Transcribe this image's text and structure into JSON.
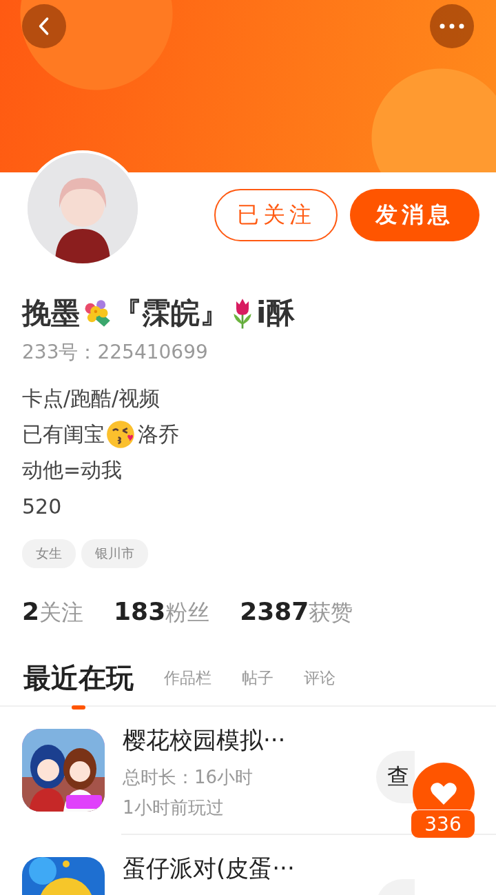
{
  "actions": [
    {
      "label": "已关注",
      "kind": "outline"
    },
    {
      "label": "发消息",
      "kind": "filled"
    }
  ],
  "name": [
    {
      "kind": "text",
      "text": "挽墨"
    },
    {
      "kind": "bouquet"
    },
    {
      "kind": "text",
      "text": "『霂皖』"
    },
    {
      "kind": "tulip"
    },
    {
      "kind": "text",
      "text": "i酥"
    }
  ],
  "id_line": "233号：225410699",
  "bio": [
    [
      {
        "kind": "text",
        "text": "卡点/跑酷/视频"
      }
    ],
    [
      {
        "kind": "text",
        "text": "已有闺宝"
      },
      {
        "kind": "kiss"
      },
      {
        "kind": "text",
        "text": "洛乔"
      }
    ],
    [
      {
        "kind": "text",
        "text": "动他=动我"
      }
    ],
    [
      {
        "kind": "text",
        "text": "520"
      }
    ]
  ],
  "tags": [
    "女生",
    "银川市"
  ],
  "stats": [
    "**2**关注",
    "**183**粉丝",
    "**2387**获赞"
  ],
  "tabs": [
    {
      "label": "最近在玩",
      "selected": true
    },
    {
      "label": "作品栏",
      "selected": false
    },
    {
      "label": "帖子",
      "selected": false
    },
    {
      "label": "评论",
      "selected": false
    }
  ],
  "games": [
    {
      "title": "樱花校园模拟···",
      "duration": "总时长：16小时",
      "last_played": "1小时前玩过",
      "button": "查"
    },
    {
      "title": "蛋仔派对(皮蛋···"
    }
  ],
  "like_badge": {
    "count": "336"
  }
}
